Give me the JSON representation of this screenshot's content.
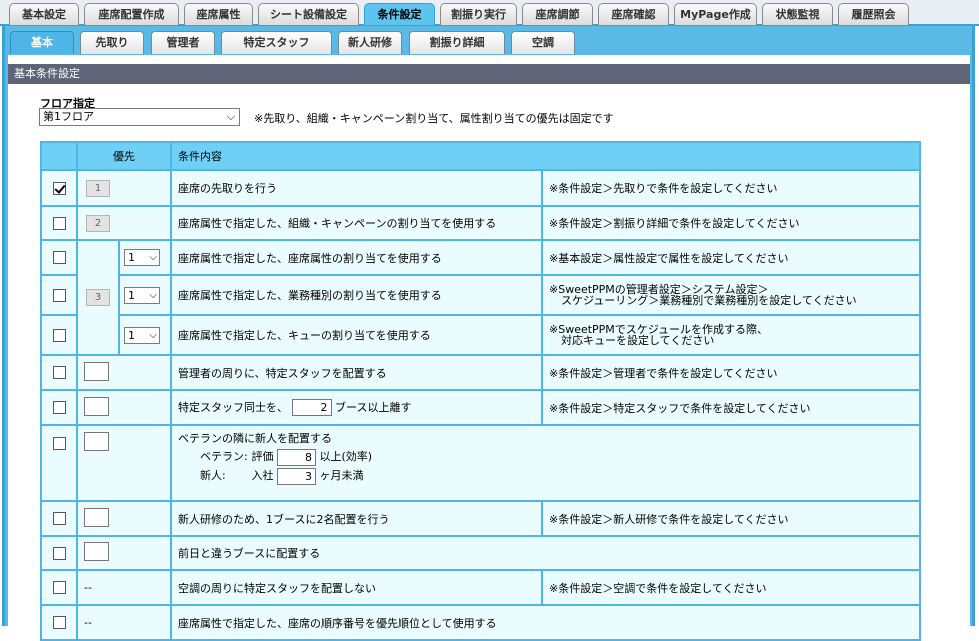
{
  "top_tabs": [
    "基本設定",
    "座席配置作成",
    "座席属性",
    "シート設備設定",
    "条件設定",
    "割振り実行",
    "座席調節",
    "座席確認",
    "MyPage作成",
    "状態監視",
    "履歴照会"
  ],
  "sub_tabs": [
    "基本",
    "先取り",
    "管理者",
    "特定スタッフ",
    "新人研修",
    "割振り詳細",
    "空調"
  ],
  "panel_title": "基本条件設定",
  "floor": {
    "label": "フロア指定",
    "selected": "第1フロア",
    "note": "※先取り、組織・キャンペーン割り当て、属性割り当ての優先は固定です"
  },
  "table": {
    "header_priority": "優先",
    "header_condition": "条件内容",
    "rows": [
      {
        "checked": true,
        "priority": "1",
        "condition": "座席の先取りを行う",
        "note": "※条件設定＞先取りで条件を設定してください"
      },
      {
        "checked": false,
        "priority": "2",
        "condition": "座席属性で指定した、組織・キャンペーンの割り当てを使用する",
        "note": "※条件設定＞割振り詳細で条件を設定してください"
      },
      {
        "checked": false,
        "priority": "3",
        "sub": "1",
        "condition": "座席属性で指定した、座席属性の割り当てを使用する",
        "note": "※基本設定＞属性設定で属性を設定してください"
      },
      {
        "checked": false,
        "sub": "1",
        "condition": "座席属性で指定した、業務種別の割り当てを使用する",
        "note_l1": "※SweetPPMの管理者設定＞システム設定＞",
        "note_l2": "スケジューリング＞業務種別で業務種別を設定してください"
      },
      {
        "checked": false,
        "sub": "1",
        "condition": "座席属性で指定した、キューの割り当てを使用する",
        "note_l1": "※SweetPPMでスケジュールを作成する際、",
        "note_l2": "対応キューを設定してください"
      },
      {
        "checked": false,
        "condition": "管理者の周りに、特定スタッフを配置する",
        "note": "※条件設定＞管理者で条件を設定してください"
      },
      {
        "checked": false,
        "condition_prefix": "特定スタッフ同士を、",
        "value": "2",
        "condition_suffix": "ブース以上離す",
        "note": "※条件設定＞特定スタッフで条件を設定してください"
      },
      {
        "checked": false,
        "condition": "ベテランの隣に新人を配置する",
        "vet_label": "ベテラン:",
        "vet_sub": "評価",
        "vet_value": "8",
        "vet_suffix": "以上(効率)",
        "new_label": "新人:",
        "new_sub": "入社",
        "new_value": "3",
        "new_suffix": "ヶ月未満"
      },
      {
        "checked": false,
        "condition": "新人研修のため、1ブースに2名配置を行う",
        "note": "※条件設定＞新人研修で条件を設定してください"
      },
      {
        "checked": false,
        "condition": "前日と違うブースに配置する"
      },
      {
        "checked": false,
        "priority": "--",
        "condition": "空調の周りに特定スタッフを配置しない",
        "note": "※条件設定＞空調で条件を設定してください"
      },
      {
        "checked": false,
        "priority": "--",
        "condition": "座席属性で指定した、座席の順序番号を優先順位として使用する"
      }
    ]
  }
}
